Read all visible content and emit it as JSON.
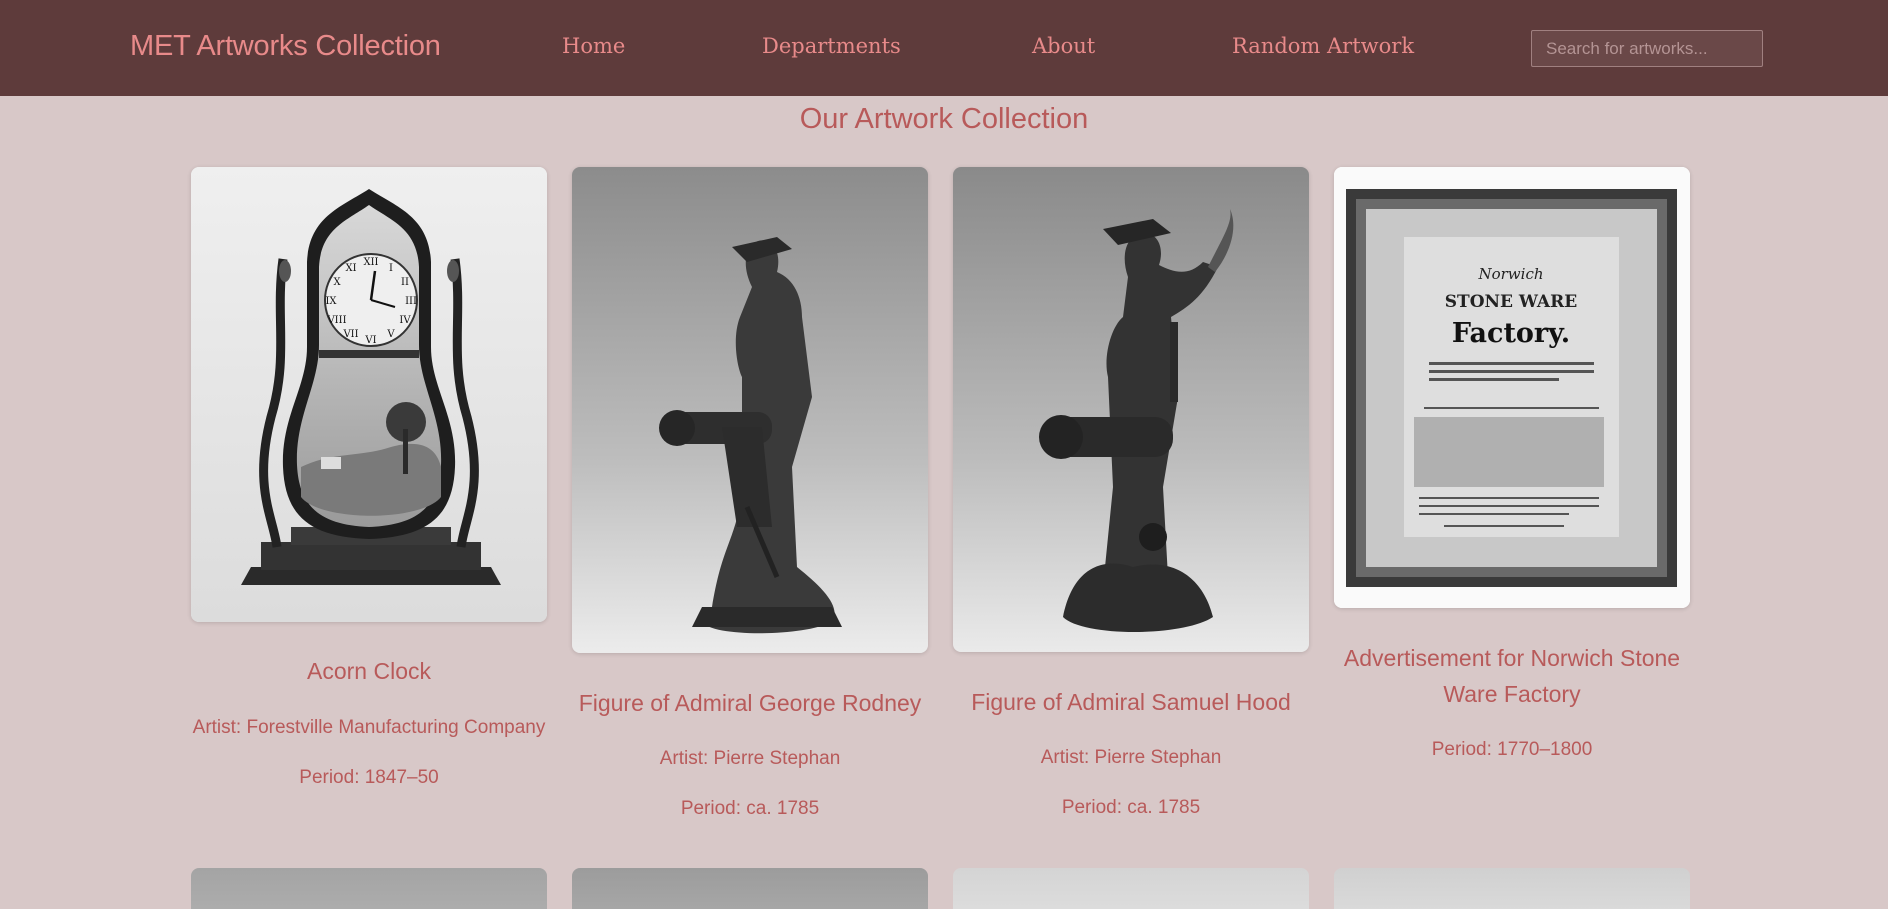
{
  "header": {
    "brand": "MET Artworks Collection",
    "nav": [
      "Home",
      "Departments",
      "About",
      "Random Artwork"
    ],
    "search_placeholder": "Search for artworks..."
  },
  "main": {
    "title": "Our Artwork Collection",
    "artworks": [
      {
        "title": "Acorn Clock",
        "artist": "Artist: Forestville Manufacturing Company",
        "period": "Period: 1847–50"
      },
      {
        "title": "Figure of Admiral George Rodney",
        "artist": "Artist: Pierre Stephan",
        "period": "Period: ca. 1785"
      },
      {
        "title": "Figure of Admiral Samuel Hood",
        "artist": "Artist: Pierre Stephan",
        "period": "Period: ca. 1785"
      },
      {
        "title_line1": "Advertisement for Norwich Stone",
        "title_line2": "Ware Factory",
        "period": "Period: 1770–1800"
      }
    ],
    "poster": {
      "line1": "Norwich",
      "line2": "STONE WARE",
      "line3": "Factory."
    }
  },
  "colors": {
    "header_bg": "#5e3b3b",
    "page_bg": "#d8c8c8",
    "accent": "#e88a8a",
    "text": "#b85a5a"
  }
}
